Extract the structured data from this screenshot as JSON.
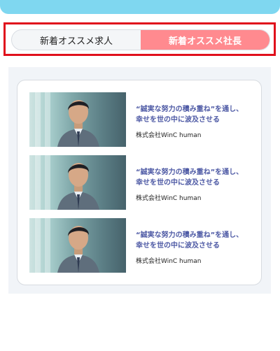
{
  "tabs": [
    {
      "label": "新着オススメ求人",
      "active": false
    },
    {
      "label": "新着オススメ社長",
      "active": true
    }
  ],
  "list": {
    "items": [
      {
        "line1": "“誠実な努力の積み重ね”を通し、",
        "line2": "幸せを世の中に波及させる",
        "company": "株式会社WinC human",
        "image": "portrait-of-businessman-in-gray-suit"
      },
      {
        "line1": "“誠実な努力の積み重ね”を通し、",
        "line2": "幸せを世の中に波及させる",
        "company": "株式会社WinC human",
        "image": "portrait-of-businessman-in-gray-suit"
      },
      {
        "line1": "“誠実な努力の積み重ね”を通し、",
        "line2": "幸せを世の中に波及させる",
        "company": "株式会社WinC human",
        "image": "portrait-of-businessman-in-gray-suit"
      }
    ]
  },
  "colors": {
    "top_bar": "#7fd7f0",
    "active_tab": "#ff8a8f",
    "highlight_border": "#e0101c",
    "quote_text": "#4e5aa5"
  }
}
